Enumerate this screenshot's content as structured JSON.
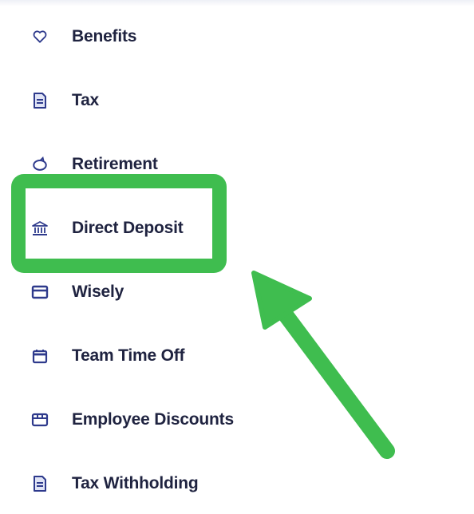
{
  "menu": {
    "items": [
      {
        "label": "Benefits",
        "icon": "heart-icon"
      },
      {
        "label": "Tax",
        "icon": "document-icon"
      },
      {
        "label": "Retirement",
        "icon": "piggy-bank-icon"
      },
      {
        "label": "Direct Deposit",
        "icon": "bank-icon"
      },
      {
        "label": "Wisely",
        "icon": "card-icon"
      },
      {
        "label": "Team Time Off",
        "icon": "calendar-icon"
      },
      {
        "label": "Employee Discounts",
        "icon": "ticket-icon"
      },
      {
        "label": "Tax Withholding",
        "icon": "document-icon"
      }
    ]
  },
  "annotation": {
    "highlight_color": "#3fbd4f",
    "icon_color": "#2e3a8c",
    "text_color": "#1f2340"
  }
}
